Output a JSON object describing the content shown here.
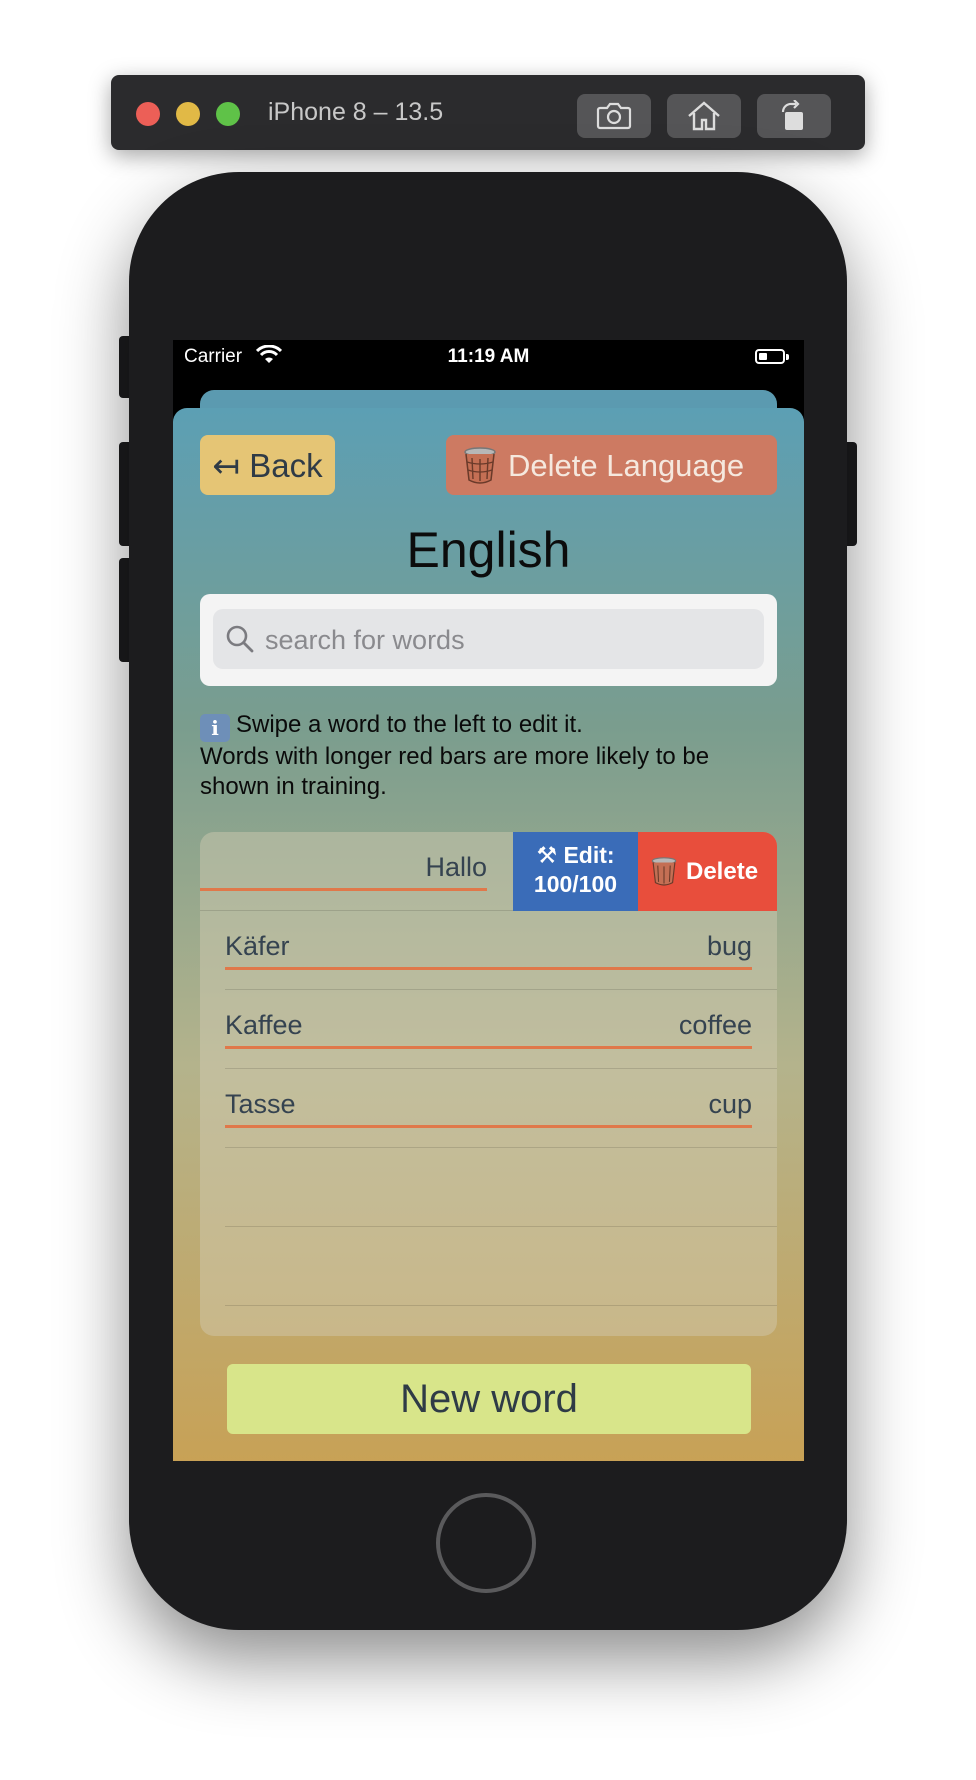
{
  "simulator": {
    "title": "iPhone 8 – 13.5",
    "buttons": [
      "screenshot-icon",
      "home-icon",
      "rotate-icon"
    ]
  },
  "status_bar": {
    "carrier": "Carrier",
    "time": "11:19 AM",
    "battery_level": 0.2
  },
  "header": {
    "back_label": "↤ Back",
    "delete_language_label": "Delete Language",
    "title": "English"
  },
  "search": {
    "placeholder": "search for words",
    "value": ""
  },
  "info": {
    "icon": "info-icon",
    "icon_char": "i",
    "line1": "Swipe a word to the left to edit it.",
    "line2": "Words with longer red bars are more likely to be shown in training."
  },
  "words": [
    {
      "term": "Hallo",
      "translation": "",
      "swiped": true
    },
    {
      "term": "Käfer",
      "translation": "bug"
    },
    {
      "term": "Kaffee",
      "translation": "coffee"
    },
    {
      "term": "Tasse",
      "translation": "cup"
    }
  ],
  "swipe_actions": {
    "edit_icon": "⚒",
    "edit_label": "Edit:",
    "edit_value": "100/100",
    "delete_label": "Delete"
  },
  "footer": {
    "new_word_label": "New word"
  },
  "colors": {
    "back_button": "#e5c575",
    "delete_language_button": "#cd7a62",
    "edit_action": "#3a6cb8",
    "delete_action": "#e84e3c",
    "word_bar": "#e0784a",
    "new_word_button": "#d8e58a"
  }
}
